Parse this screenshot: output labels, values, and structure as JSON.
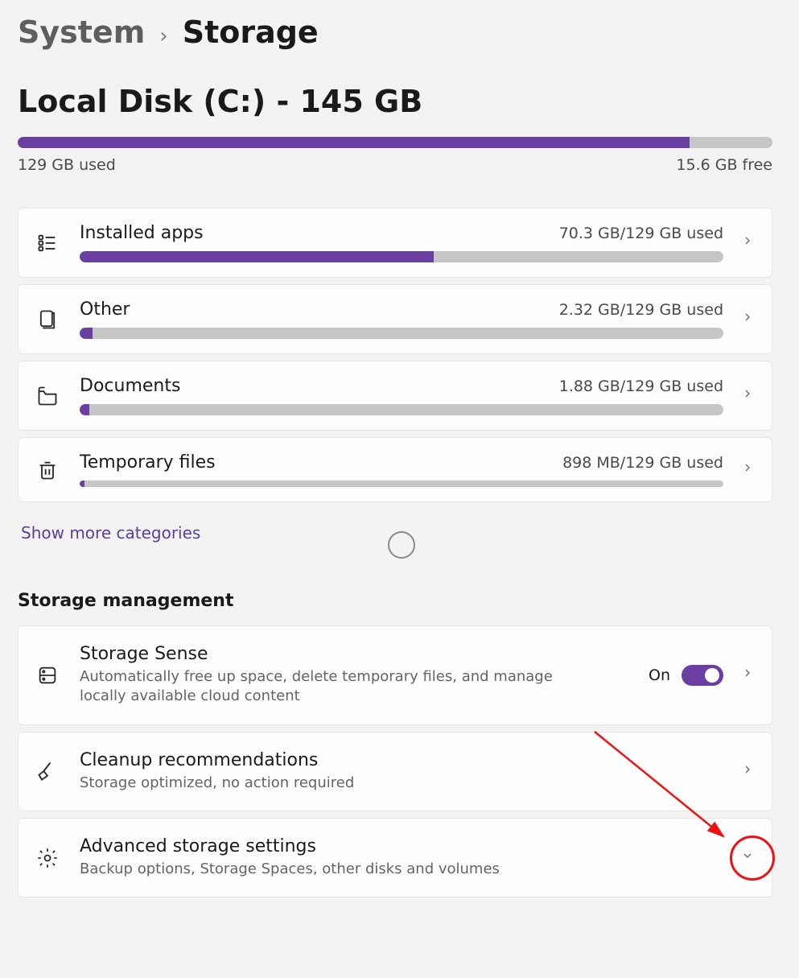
{
  "breadcrumb": {
    "parent": "System",
    "current": "Storage"
  },
  "disk": {
    "title": "Local Disk (C:) - 145 GB",
    "used_label": "129 GB used",
    "free_label": "15.6 GB free",
    "used_gb": 129,
    "total_gb": 145,
    "fill_pct": 89
  },
  "categories": [
    {
      "id": "installed-apps",
      "icon": "apps-icon",
      "title": "Installed apps",
      "usage": "70.3 GB/129 GB used",
      "fill_pct": 55
    },
    {
      "id": "other",
      "icon": "other-icon",
      "title": "Other",
      "usage": "2.32 GB/129 GB used",
      "fill_pct": 2
    },
    {
      "id": "documents",
      "icon": "documents-icon",
      "title": "Documents",
      "usage": "1.88 GB/129 GB used",
      "fill_pct": 1.5
    },
    {
      "id": "temporary-files",
      "icon": "trash-icon",
      "title": "Temporary files",
      "usage": "898 MB/129 GB used",
      "fill_pct": 0.7
    }
  ],
  "show_more": "Show more categories",
  "section_heading": "Storage management",
  "management": [
    {
      "id": "storage-sense",
      "icon": "drive-icon",
      "title": "Storage Sense",
      "subtitle": "Automatically free up space, delete temporary files, and manage locally available cloud content",
      "toggle_state_label": "On",
      "toggle_on": true,
      "chevron": "right"
    },
    {
      "id": "cleanup-recommendations",
      "icon": "broom-icon",
      "title": "Cleanup recommendations",
      "subtitle": "Storage optimized, no action required",
      "chevron": "right"
    },
    {
      "id": "advanced-storage-settings",
      "icon": "gear-icon",
      "title": "Advanced storage settings",
      "subtitle": "Backup options, Storage Spaces, other disks and volumes",
      "chevron": "down"
    }
  ]
}
